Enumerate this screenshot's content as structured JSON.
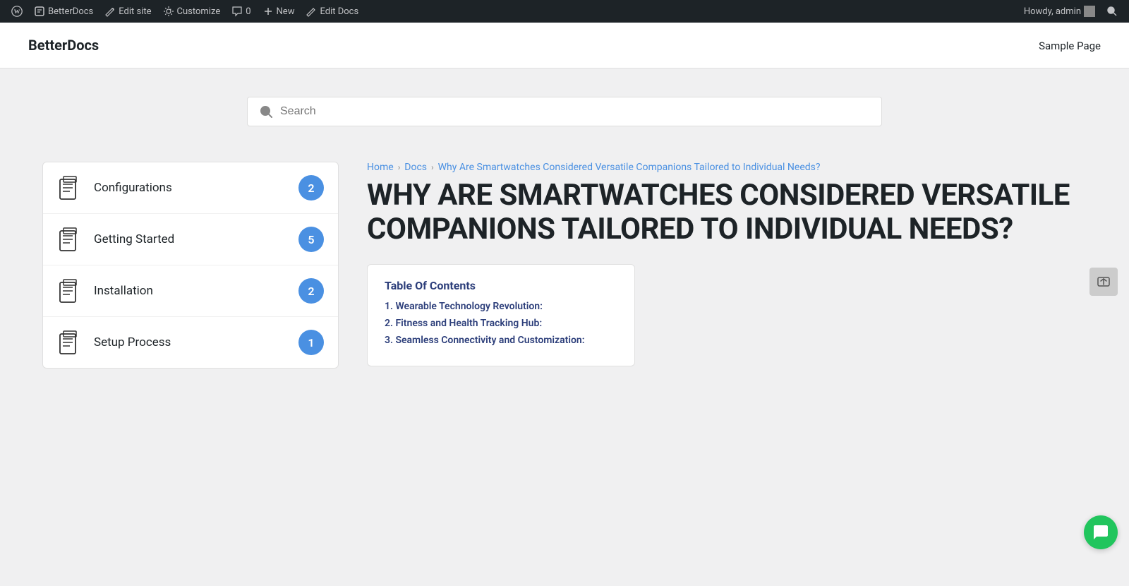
{
  "adminBar": {
    "wpLogoLabel": "WordPress",
    "betterDocsLabel": "BetterDocs",
    "editSiteLabel": "Edit site",
    "customizeLabel": "Customize",
    "commentsLabel": "0",
    "newLabel": "New",
    "editDocsLabel": "Edit Docs",
    "howdyLabel": "Howdy, admin",
    "searchLabel": "Search"
  },
  "siteHeader": {
    "title": "BetterDocs",
    "navItem": "Sample Page"
  },
  "search": {
    "placeholder": "Search"
  },
  "sidebar": {
    "items": [
      {
        "label": "Configurations",
        "count": "2"
      },
      {
        "label": "Getting Started",
        "count": "5"
      },
      {
        "label": "Installation",
        "count": "2"
      },
      {
        "label": "Setup Process",
        "count": "1"
      }
    ]
  },
  "breadcrumb": {
    "home": "Home",
    "docs": "Docs",
    "current": "Why Are Smartwatches Considered Versatile Companions Tailored to Individual Needs?"
  },
  "article": {
    "title": "WHY ARE SMARTWATCHES CONSIDERED VERSATILE COMPANIONS TAILORED TO INDIVIDUAL NEEDS?",
    "toc": {
      "heading": "Table Of Contents",
      "items": [
        "1. Wearable Technology Revolution:",
        "2. Fitness and Health Tracking Hub:",
        "3. Seamless Connectivity and Customization:"
      ]
    }
  }
}
